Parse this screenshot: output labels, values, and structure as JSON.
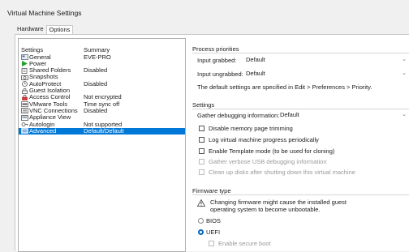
{
  "window": {
    "title": "Virtual Machine Settings"
  },
  "tabs": [
    {
      "label": "Hardware"
    },
    {
      "label": "Options"
    }
  ],
  "list": {
    "header": {
      "col1": "Settings",
      "col2": "Summary"
    },
    "items": [
      {
        "name": "General",
        "summary": "EVE-PRO",
        "icon": "general-icon"
      },
      {
        "name": "Power",
        "summary": "",
        "icon": "power-icon"
      },
      {
        "name": "Shared Folders",
        "summary": "Disabled",
        "icon": "shared-folders-icon"
      },
      {
        "name": "Snapshots",
        "summary": "",
        "icon": "snapshots-icon"
      },
      {
        "name": "AutoProtect",
        "summary": "Disabled",
        "icon": "autoprotect-icon"
      },
      {
        "name": "Guest Isolation",
        "summary": "",
        "icon": "guest-isolation-icon"
      },
      {
        "name": "Access Control",
        "summary": "Not encrypted",
        "icon": "access-control-icon"
      },
      {
        "name": "VMware Tools",
        "summary": "Time sync off",
        "icon": "vmware-tools-icon"
      },
      {
        "name": "VNC Connections",
        "summary": "Disabled",
        "icon": "vnc-icon"
      },
      {
        "name": "Appliance View",
        "summary": "",
        "icon": "appliance-view-icon"
      },
      {
        "name": "Autologin",
        "summary": "Not supported",
        "icon": "autologin-icon"
      },
      {
        "name": "Advanced",
        "summary": "Default/Default",
        "icon": "advanced-icon",
        "selected": true
      }
    ]
  },
  "process_priorities": {
    "title": "Process priorities",
    "grabbed_label": "Input grabbed:",
    "grabbed_value": "Default",
    "ungrabbed_label": "Input ungrabbed:",
    "ungrabbed_value": "Default",
    "note": "The default settings are specified in Edit > Preferences > Priority."
  },
  "settings": {
    "title": "Settings",
    "debug_label": "Gather debugging information:",
    "debug_value": "Default",
    "checkboxes": [
      {
        "label": "Disable memory page trimming",
        "enabled": true
      },
      {
        "label": "Log virtual machine progress periodically",
        "enabled": true
      },
      {
        "label": "Enable Template mode (to be used for cloning)",
        "enabled": true
      },
      {
        "label": "Gather verbose USB debugging information",
        "enabled": false
      },
      {
        "label": "Clean up disks after shutting down this virtual machine",
        "enabled": false
      }
    ]
  },
  "firmware": {
    "title": "Firmware type",
    "warning_line1": "Changing firmware might cause the installed guest",
    "warning_line2": "operating system to become unbootable.",
    "bios_label": "BIOS",
    "uefi_label": "UEFI",
    "selected": "UEFI",
    "secure_boot_label": "Enable secure boot"
  }
}
